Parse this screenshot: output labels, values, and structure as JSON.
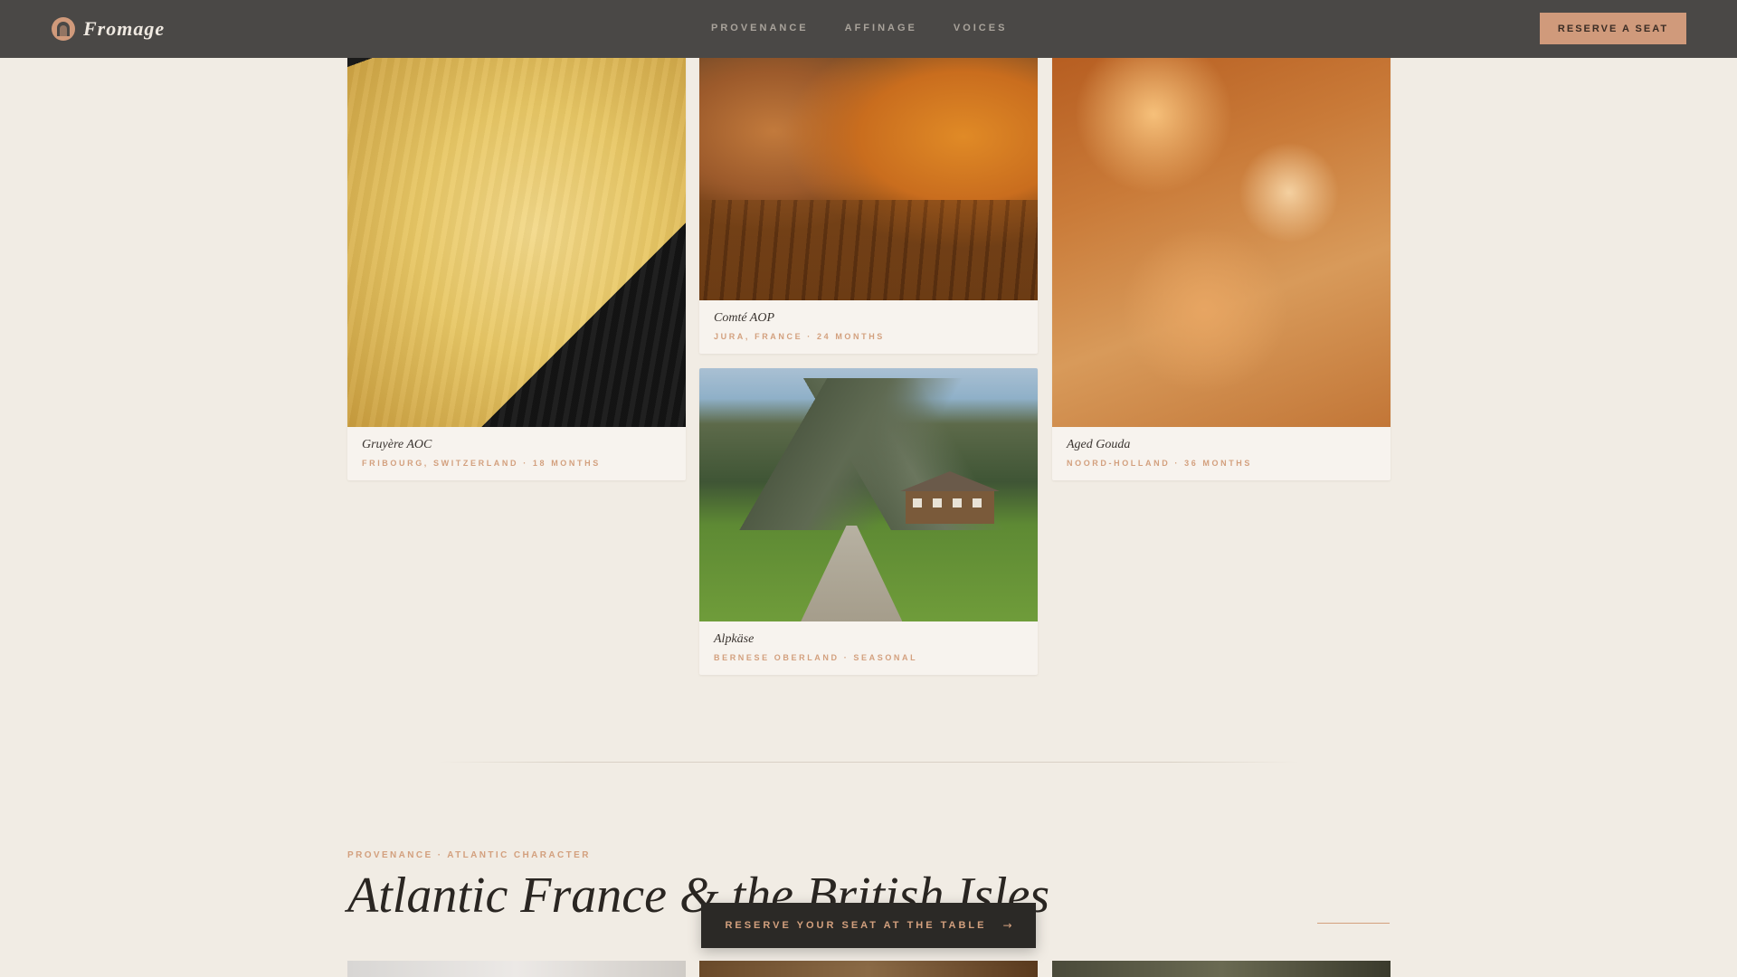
{
  "nav": {
    "brand": "Fromage",
    "logo_icon": "arch-logo-icon",
    "links": [
      "PROVENANCE",
      "AFFINAGE",
      "VOICES"
    ],
    "cta_label": "RESERVE A SEAT"
  },
  "cards": [
    {
      "name": "Gruyère AOC",
      "meta": "FRIBOURG, SWITZERLAND · 18 MONTHS"
    },
    {
      "name": "Comté AOP",
      "meta": "JURA, FRANCE · 24 MONTHS"
    },
    {
      "name": "Aged Gouda",
      "meta": "NOORD-HOLLAND · 36 MONTHS"
    },
    {
      "name": "Alpkäse",
      "meta": "BERNESE OBERLAND · SEASONAL"
    }
  ],
  "section": {
    "eyebrow": "PROVENANCE · ATLANTIC CHARACTER",
    "title": "Atlantic France & the British Isles"
  },
  "floating_cta": {
    "label": "RESERVE YOUR SEAT AT THE TABLE",
    "arrow": "→"
  },
  "colors": {
    "accent": "#d09a7b",
    "nav_bg": "#4a4846",
    "page_bg": "#f1ece4"
  }
}
